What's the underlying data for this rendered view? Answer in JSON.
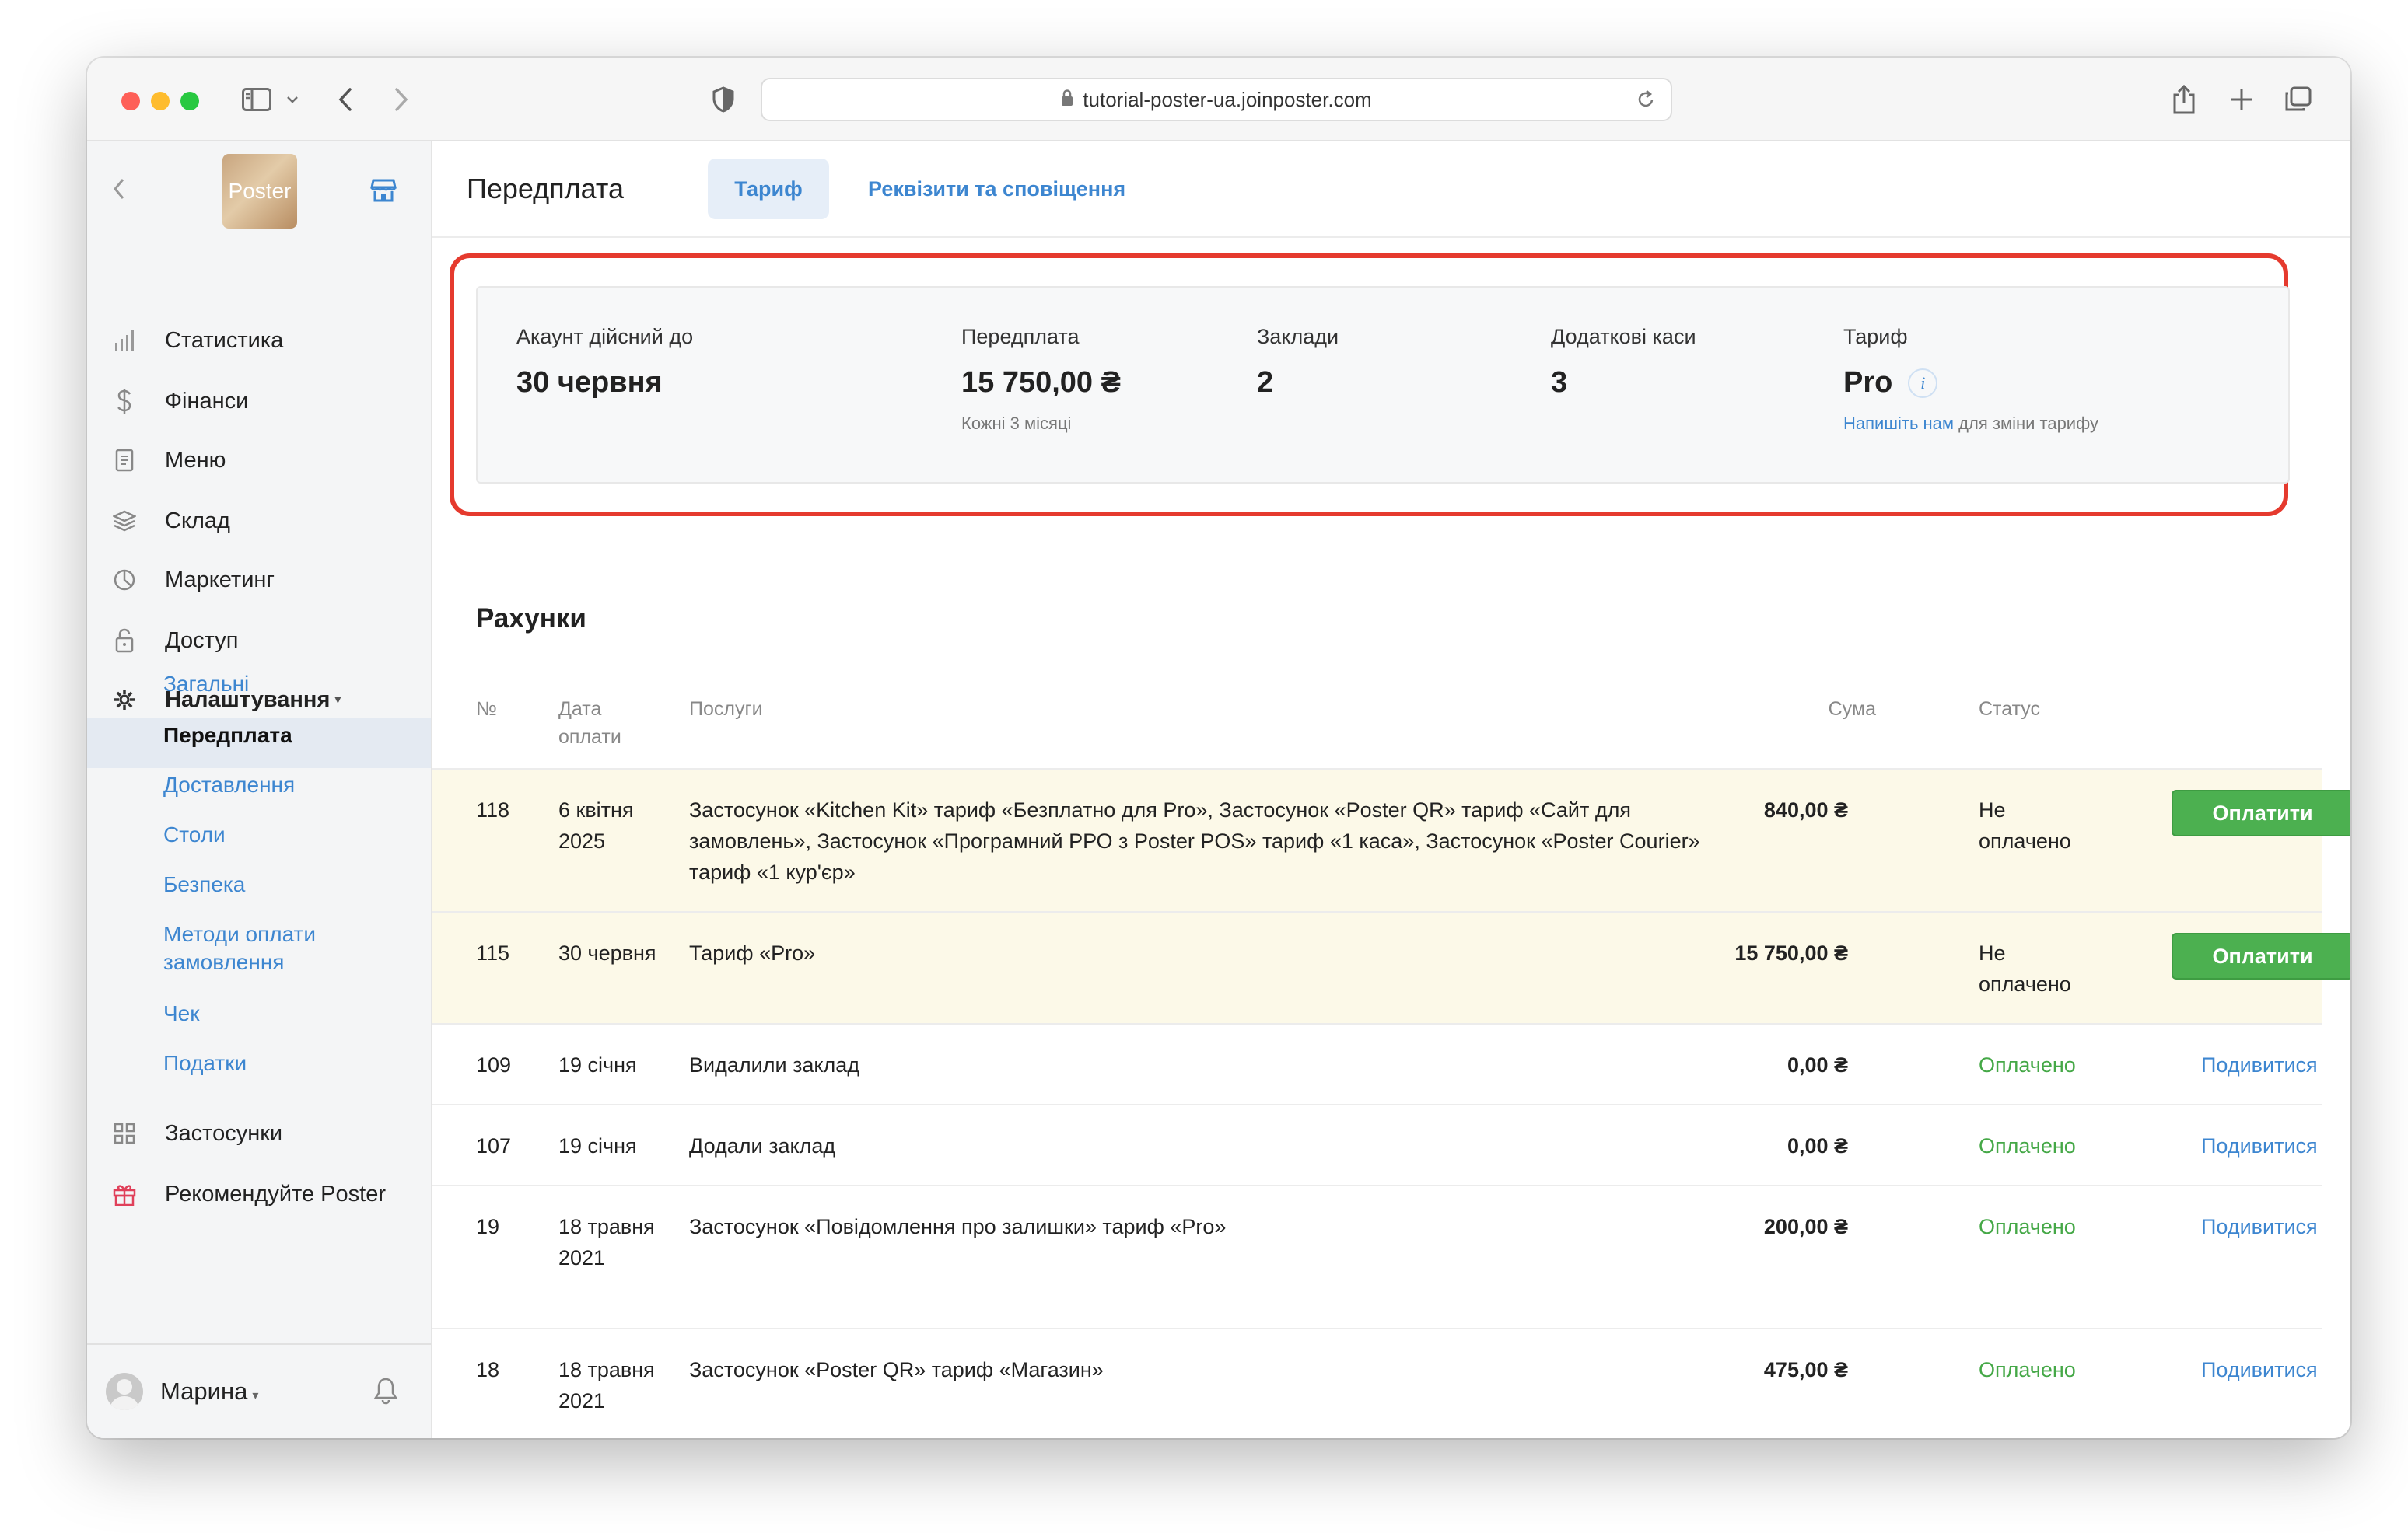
{
  "browser": {
    "url": "tutorial-poster-ua.joinposter.com"
  },
  "sidebar": {
    "logo_text": "Poster",
    "nav": [
      {
        "label": "Статистика",
        "icon": "bar-chart-icon"
      },
      {
        "label": "Фінанси",
        "icon": "dollar-icon"
      },
      {
        "label": "Меню",
        "icon": "document-icon"
      },
      {
        "label": "Склад",
        "icon": "layers-icon"
      },
      {
        "label": "Маркетинг",
        "icon": "pie-chart-icon"
      },
      {
        "label": "Доступ",
        "icon": "lock-icon"
      },
      {
        "label": "Налаштування",
        "icon": "gear-icon"
      }
    ],
    "settings_items": [
      "Загальні",
      "Передплата",
      "Доставлення",
      "Столи",
      "Безпека",
      "Методи оплати замовлення",
      "Чек",
      "Податки"
    ],
    "apps_label": "Застосунки",
    "recommend_label": "Рекомендуйте Poster",
    "user_name": "Марина"
  },
  "header": {
    "title": "Передплата",
    "tabs": [
      "Тариф",
      "Реквізити та сповіщення"
    ]
  },
  "summary": {
    "account_label": "Акаунт дійсний до",
    "account_value": "30 червня",
    "subscription_label": "Передплата",
    "subscription_value": "15 750,00 ₴",
    "subscription_note": "Кожні 3 місяці",
    "venues_label": "Заклади",
    "venues_value": "2",
    "registers_label": "Додаткові каси",
    "registers_value": "3",
    "plan_label": "Тариф",
    "plan_value": "Pro",
    "plan_info": "i",
    "plan_link": "Напишіть нам",
    "plan_note": "для зміни тарифу"
  },
  "invoices": {
    "title": "Рахунки",
    "columns": {
      "num": "№",
      "date": "Дата оплати",
      "services": "Послуги",
      "amount": "Сума",
      "status": "Статус"
    },
    "rows": [
      {
        "num": "118",
        "date": "6 квітня 2025",
        "services": "Застосунок «Kitchen Kit» тариф «Безплатно для Pro», Застосунок «Poster QR» тариф «Сайт для замовлень», Застосунок «Програмний РРО з Poster POS» тариф «1 каса», Застосунок «Poster Courier» тариф «1 кур'єр»",
        "amount": "840,00 ₴",
        "status": "Не оплачено",
        "action": "Оплатити"
      },
      {
        "num": "115",
        "date": "30 червня",
        "services": "Тариф «Pro»",
        "amount": "15 750,00 ₴",
        "status": "Не оплачено",
        "action": "Оплатити"
      },
      {
        "num": "109",
        "date": "19 січня",
        "services": "Видалили заклад",
        "amount": "0,00 ₴",
        "status": "Оплачено",
        "action": "Подивитися"
      },
      {
        "num": "107",
        "date": "19 січня",
        "services": "Додали заклад",
        "amount": "0,00 ₴",
        "status": "Оплачено",
        "action": "Подивитися"
      },
      {
        "num": "19",
        "date": "18 травня 2021",
        "services": "Застосунок «Повідомлення про залишки» тариф «Pro»",
        "amount": "200,00 ₴",
        "status": "Оплачено",
        "action": "Подивитися"
      },
      {
        "num": "18",
        "date": "18 травня 2021",
        "services": "Застосунок «Poster QR» тариф «Магазин»",
        "amount": "475,00 ₴",
        "status": "Оплачено",
        "action": "Подивитися"
      }
    ]
  },
  "colors": {
    "accent": "#3d86d0",
    "pay_button": "#4cb050",
    "paid_status": "#45a847",
    "highlight_box": "#e53a2e",
    "unpaid_row": "#fcf9e8"
  }
}
